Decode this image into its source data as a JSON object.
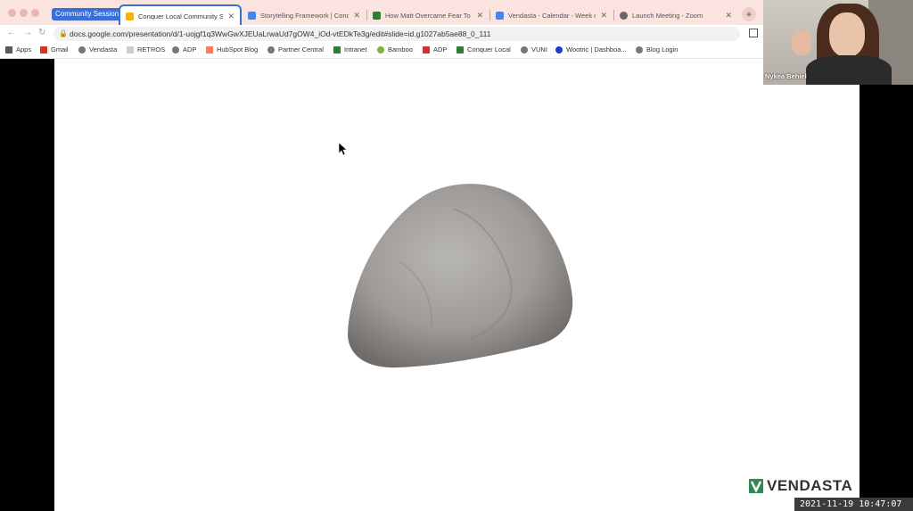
{
  "browser": {
    "tab_group_label": "Community Session",
    "tabs": [
      {
        "title": "Conquer Local Community Ses",
        "active": true,
        "favicon_color": "#f4b400"
      },
      {
        "title": "Storytelling Framework | Conq",
        "active": false,
        "favicon_color": "#4285f4"
      },
      {
        "title": "How Matt Overcame Fear To M",
        "active": false,
        "favicon_color": "#2e7d32"
      },
      {
        "title": "Vendasta - Calendar - Week o",
        "active": false,
        "favicon_color": "#4285f4"
      },
      {
        "title": "Launch Meeting - Zoom",
        "active": false,
        "favicon_color": "#666666"
      }
    ],
    "url": "docs.google.com/presentation/d/1-uojgf1q3WwGwXJEUaLrwaUd7gOW4_iOd-vtEDkTe3g/edit#slide=id.g1027ab5ae88_0_111",
    "bookmarks": [
      "Apps",
      "Gmail",
      "Vendasta",
      "RETROS",
      "ADP",
      "HubSpot Blog",
      "Partner Central",
      "Intranet",
      "Bamboo",
      "ADP",
      "Conquer Local",
      "VUNI",
      "Wootric | Dashboa...",
      "Blog Login"
    ]
  },
  "slide": {
    "logo_text": "VENDASTA",
    "logo_color": "#2e8b57"
  },
  "video": {
    "participant_name": "Nykea Behiel"
  },
  "timestamp": "2021-11-19 10:47:07"
}
